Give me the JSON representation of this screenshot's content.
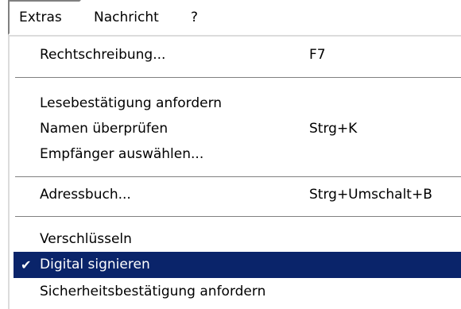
{
  "menubar": {
    "items": [
      {
        "label": "Extras"
      },
      {
        "label": "Nachricht"
      },
      {
        "label": "?"
      }
    ]
  },
  "menu": {
    "items": [
      {
        "label": "Rechtschreibung...",
        "shortcut": "F7"
      },
      {
        "label": "Lesebestätigung anfordern",
        "shortcut": ""
      },
      {
        "label": "Namen überprüfen",
        "shortcut": "Strg+K"
      },
      {
        "label": "Empfänger auswählen...",
        "shortcut": ""
      },
      {
        "label": "Adressbuch...",
        "shortcut": "Strg+Umschalt+B"
      },
      {
        "label": "Verschlüsseln",
        "shortcut": ""
      },
      {
        "label": "Digital signieren",
        "shortcut": "",
        "checked": true,
        "selected": true
      },
      {
        "label": "Sicherheitsbestätigung anfordern",
        "shortcut": ""
      }
    ],
    "check_glyph": "✔"
  },
  "colors": {
    "highlight": "#0a246a",
    "highlight_text": "#ffffff",
    "separator": "#808080"
  }
}
